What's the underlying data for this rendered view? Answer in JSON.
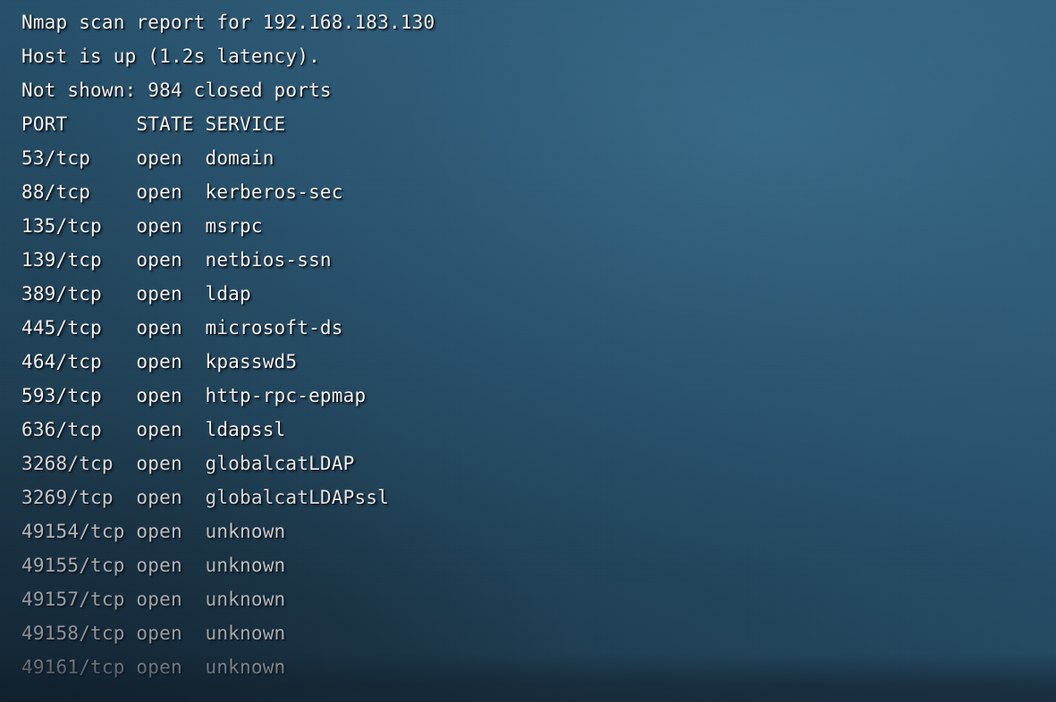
{
  "terminal": {
    "report_line": "Nmap scan report for 192.168.183.130",
    "host_status_line": "Host is up (1.2s latency).",
    "not_shown_line": "Not shown: 984 closed ports",
    "target_host": "192.168.183.130",
    "latency": "1.2s",
    "closed_ports_count": "984",
    "columns": {
      "port": "PORT",
      "state": "STATE",
      "service": "SERVICE"
    },
    "header_line": "PORT      STATE SERVICE",
    "rows": [
      {
        "port": "53/tcp",
        "state": "open",
        "service": "domain",
        "line": "53/tcp    open  domain"
      },
      {
        "port": "88/tcp",
        "state": "open",
        "service": "kerberos-sec",
        "line": "88/tcp    open  kerberos-sec"
      },
      {
        "port": "135/tcp",
        "state": "open",
        "service": "msrpc",
        "line": "135/tcp   open  msrpc"
      },
      {
        "port": "139/tcp",
        "state": "open",
        "service": "netbios-ssn",
        "line": "139/tcp   open  netbios-ssn"
      },
      {
        "port": "389/tcp",
        "state": "open",
        "service": "ldap",
        "line": "389/tcp   open  ldap"
      },
      {
        "port": "445/tcp",
        "state": "open",
        "service": "microsoft-ds",
        "line": "445/tcp   open  microsoft-ds"
      },
      {
        "port": "464/tcp",
        "state": "open",
        "service": "kpasswd5",
        "line": "464/tcp   open  kpasswd5"
      },
      {
        "port": "593/tcp",
        "state": "open",
        "service": "http-rpc-epmap",
        "line": "593/tcp   open  http-rpc-epmap"
      },
      {
        "port": "636/tcp",
        "state": "open",
        "service": "ldapssl",
        "line": "636/tcp   open  ldapssl"
      },
      {
        "port": "3268/tcp",
        "state": "open",
        "service": "globalcatLDAP",
        "line": "3268/tcp  open  globalcatLDAP"
      },
      {
        "port": "3269/tcp",
        "state": "open",
        "service": "globalcatLDAPssl",
        "line": "3269/tcp  open  globalcatLDAPssl"
      },
      {
        "port": "49154/tcp",
        "state": "open",
        "service": "unknown",
        "line": "49154/tcp open  unknown"
      },
      {
        "port": "49155/tcp",
        "state": "open",
        "service": "unknown",
        "line": "49155/tcp open  unknown"
      },
      {
        "port": "49157/tcp",
        "state": "open",
        "service": "unknown",
        "line": "49157/tcp open  unknown"
      },
      {
        "port": "49158/tcp",
        "state": "open",
        "service": "unknown",
        "line": "49158/tcp open  unknown"
      },
      {
        "port": "49161/tcp",
        "state": "open",
        "service": "unknown",
        "line": "49161/tcp open  unknown"
      }
    ]
  },
  "colors": {
    "text": "#f3f3f3",
    "background_light": "#30607d",
    "background_dark": "#1a3244",
    "bottom_band": "#1a2b3c"
  }
}
